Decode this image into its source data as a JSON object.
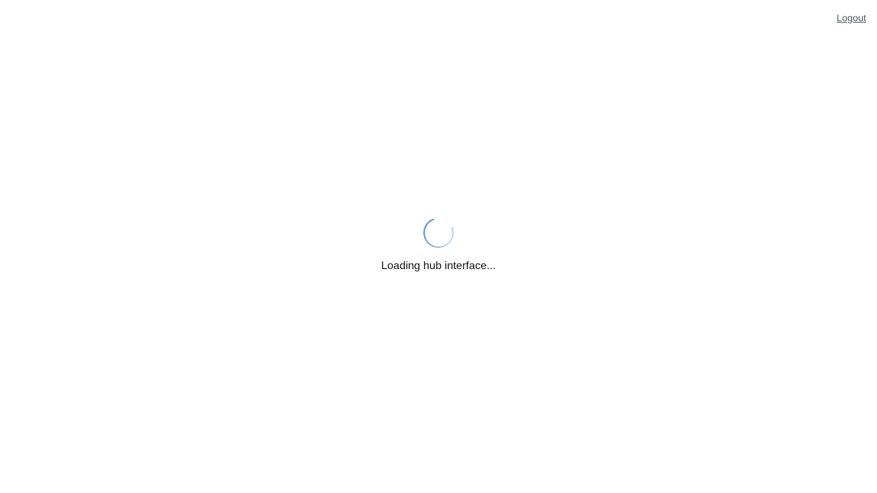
{
  "header": {
    "logout_label": "Logout"
  },
  "loader": {
    "message": "Loading hub interface...",
    "spinner_icon": "loading-spinner-icon",
    "spinner_color": "#3b74e0"
  },
  "colors": {
    "background": "#ffffff",
    "logout_text": "#4b5563",
    "message_text": "#111111"
  }
}
